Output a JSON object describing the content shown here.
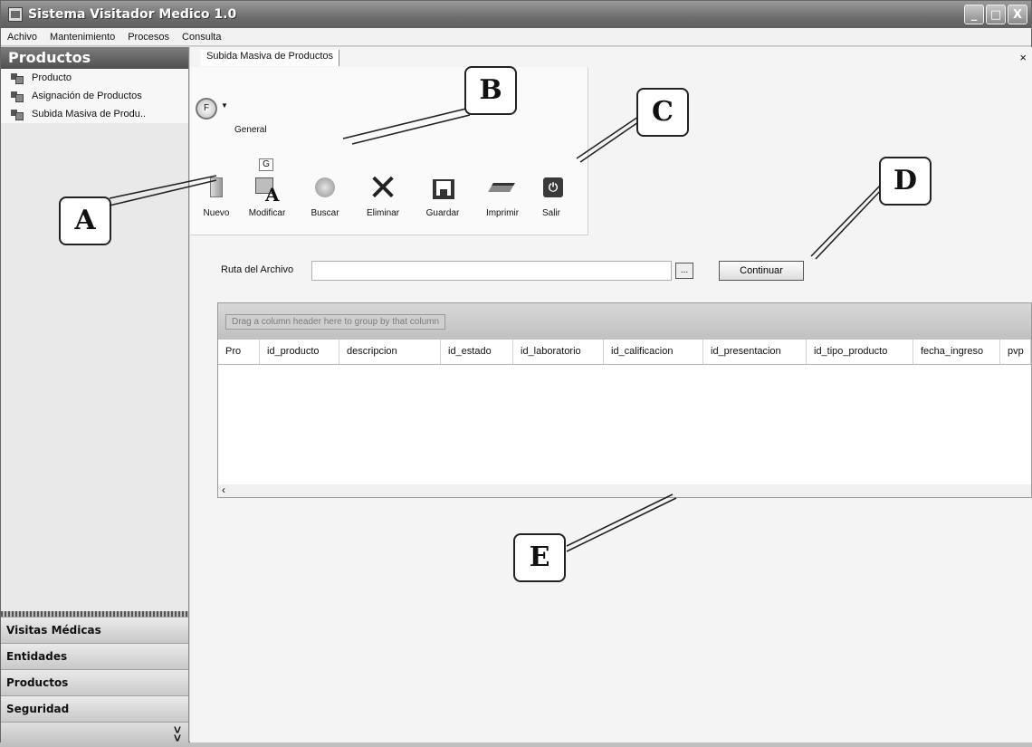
{
  "window": {
    "title": "Sistema Visitador Medico 1.0",
    "controls": {
      "minimize": "_",
      "maximize": "□",
      "close": "X"
    }
  },
  "menu": [
    "Achivo",
    "Mantenimiento",
    "Procesos",
    "Consulta"
  ],
  "sidebar": {
    "header": "Productos",
    "items": [
      {
        "label": "Producto",
        "icon": "cube-icon"
      },
      {
        "label": "Asignación de Productos",
        "icon": "cube-icon"
      },
      {
        "label": "Subida Masiva de Produ..",
        "icon": "cube-icon"
      }
    ],
    "sections": [
      "Visitas Médicas",
      "Entidades",
      "Productos",
      "Seguridad"
    ]
  },
  "document": {
    "tab_label": "Subida Masiva de Productos",
    "close_glyph": "×"
  },
  "ribbon": {
    "app_button": "F",
    "tab": "General",
    "keytip": "G",
    "tools": [
      {
        "label": "Nuevo",
        "icon": "new-document-icon"
      },
      {
        "label": "Modificar",
        "icon": "edit-icon"
      },
      {
        "label": "Buscar",
        "icon": "search-icon"
      },
      {
        "label": "Eliminar",
        "icon": "delete-icon"
      },
      {
        "label": "Guardar",
        "icon": "save-icon"
      },
      {
        "label": "Imprimir",
        "icon": "print-icon"
      },
      {
        "label": "Salir",
        "icon": "exit-icon"
      }
    ]
  },
  "file_form": {
    "label": "Ruta del Archivo",
    "value": "",
    "browse_label": "...",
    "continue_label": "Continuar"
  },
  "grid": {
    "group_hint": "Drag a column header here to group by that column",
    "columns": [
      "Pro",
      "id_producto",
      "descripcion",
      "id_estado",
      "id_laboratorio",
      "id_calificacion",
      "id_presentacion",
      "id_tipo_producto",
      "fecha_ingreso",
      "pvp"
    ],
    "rows": [],
    "scroll_left": "‹"
  },
  "callouts": [
    "A",
    "B",
    "C",
    "D",
    "E"
  ]
}
